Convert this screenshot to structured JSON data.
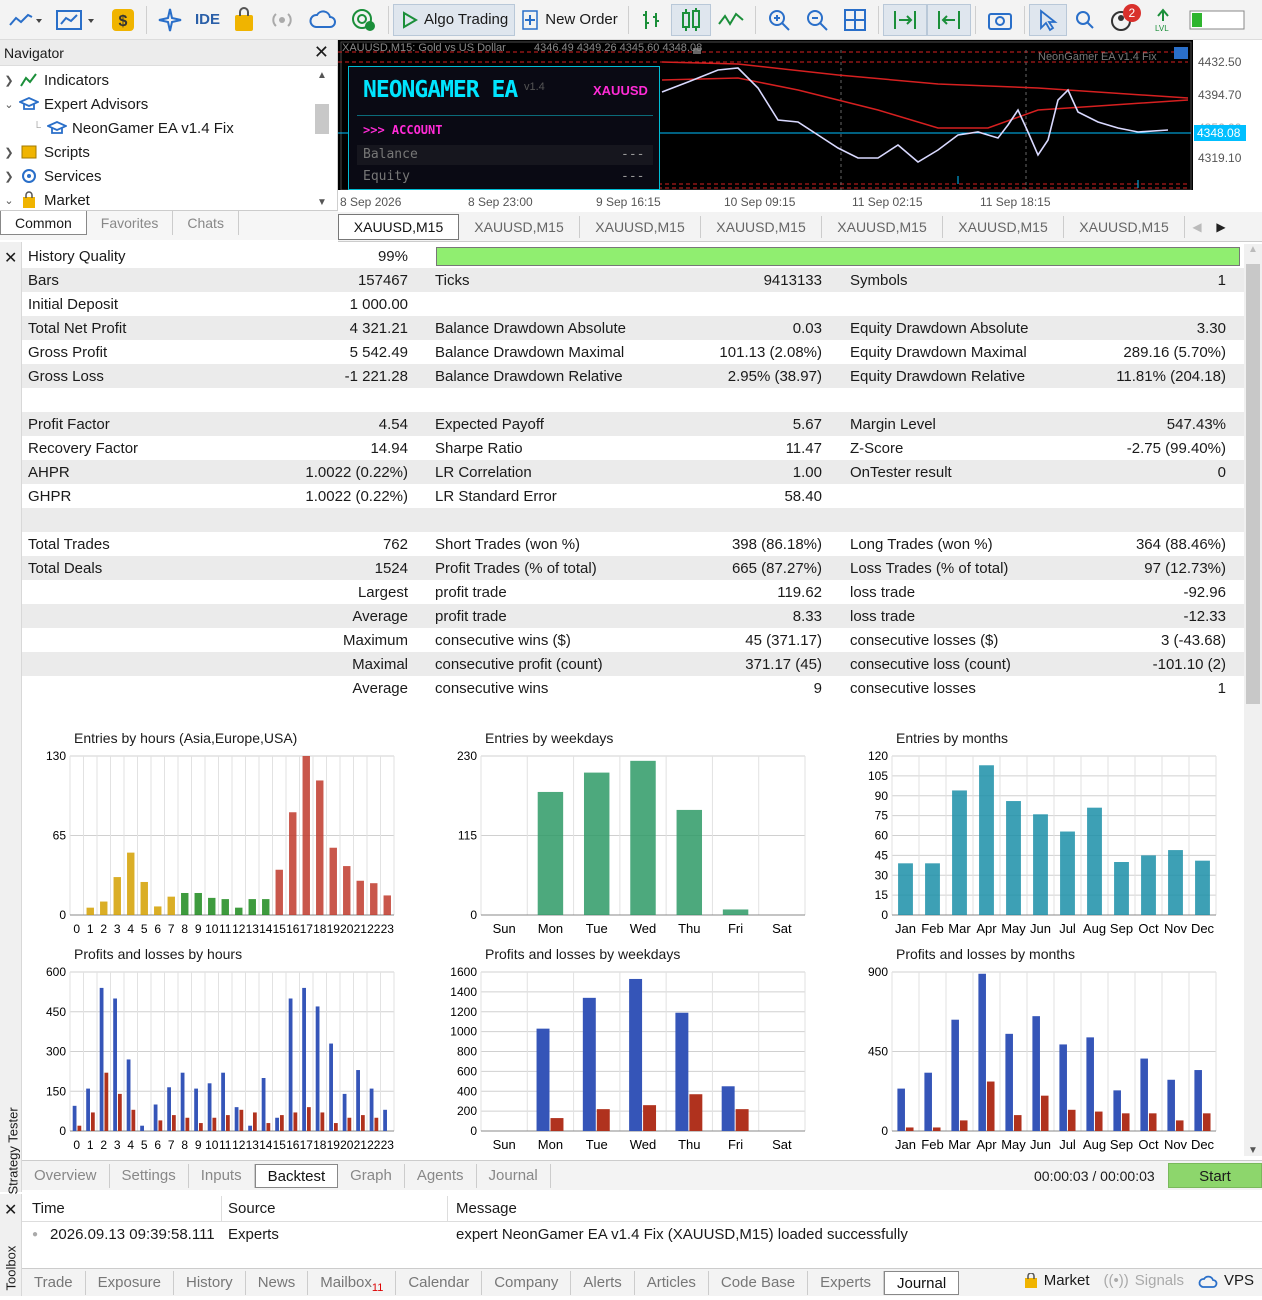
{
  "toolbar": {
    "algo_trading": "Algo Trading",
    "new_order": "New Order",
    "ide": "IDE",
    "notifications_count": "2",
    "icons": [
      "line-chart-icon",
      "dropdown-icon",
      "chart-type-icon",
      "dollar-icon",
      "sparkle-icon",
      "ide-icon",
      "shopping-bag-icon",
      "signal-icon",
      "cloud-icon",
      "vps-icon",
      "play-icon",
      "new-order-icon",
      "bar-chart-icon",
      "candle-chart-icon",
      "line-icon",
      "zoom-in-icon",
      "zoom-out-icon",
      "grid-icon",
      "autoscroll-icon",
      "chart-shift-icon",
      "screenshot-icon",
      "cursor-icon",
      "search-icon",
      "account-icon",
      "level-icon",
      "signal-strength-icon"
    ]
  },
  "navigator": {
    "title": "Navigator",
    "items": [
      {
        "label": "Indicators",
        "icon": "indicators-icon"
      },
      {
        "label": "Expert Advisors",
        "icon": "experts-icon"
      },
      {
        "label": "NeonGamer EA v1.4 Fix",
        "icon": "expert-hat-icon"
      },
      {
        "label": "Scripts",
        "icon": "scripts-icon"
      },
      {
        "label": "Services",
        "icon": "services-icon"
      },
      {
        "label": "Market",
        "icon": "market-icon"
      }
    ],
    "tabs": [
      "Common",
      "Favorites",
      "Chats"
    ]
  },
  "chart": {
    "symbol_header": "XAUUSD,M15: Gold vs US Dollar",
    "ohlc": "4346.49 4349.26 4345.60 4348.08",
    "ea_name": "NEONGAMER EA",
    "ea_version": "v1.4",
    "ea_symbol": "XAUUSD",
    "section": ">>> ACCOUNT",
    "rows": [
      {
        "label": "Balance",
        "value": "---"
      },
      {
        "label": "Equity",
        "value": "---"
      }
    ],
    "right_label": "NeonGamer EA v1.4 Fix",
    "price_labels": [
      "4432.50",
      "4394.70",
      "4356.00",
      "4348.08",
      "4319.10"
    ],
    "time_labels": [
      "8 Sep 2026",
      "8 Sep 23:00",
      "9 Sep 16:15",
      "10 Sep 09:15",
      "11 Sep 02:15",
      "11 Sep 18:15"
    ],
    "colors": {
      "bg": "#000000",
      "price": "#00bfff",
      "ma": "#d62020",
      "panel": "#00e5ff",
      "symbol": "#ff2bd6"
    }
  },
  "chart_tabs": [
    "XAUUSD,M15",
    "XAUUSD,M15",
    "XAUUSD,M15",
    "XAUUSD,M15",
    "XAUUSD,M15",
    "XAUUSD,M15",
    "XAUUSD,M15"
  ],
  "report": {
    "history_quality": {
      "label": "History Quality",
      "value": "99%",
      "fill": 0.99
    },
    "rows": [
      [
        "Bars",
        "157467",
        "Ticks",
        "9413133",
        "Symbols",
        "1"
      ],
      [
        "Initial Deposit",
        "1 000.00",
        "",
        "",
        "",
        ""
      ],
      [
        "Total Net Profit",
        "4 321.21",
        "Balance Drawdown Absolute",
        "0.03",
        "Equity Drawdown Absolute",
        "3.30"
      ],
      [
        "Gross Profit",
        "5 542.49",
        "Balance Drawdown Maximal",
        "101.13 (2.08%)",
        "Equity Drawdown Maximal",
        "289.16 (5.70%)"
      ],
      [
        "Gross Loss",
        "-1 221.28",
        "Balance Drawdown Relative",
        "2.95% (38.97)",
        "Equity Drawdown Relative",
        "11.81% (204.18)"
      ],
      [
        "",
        "",
        "",
        "",
        "",
        ""
      ],
      [
        "Profit Factor",
        "4.54",
        "Expected Payoff",
        "5.67",
        "Margin Level",
        "547.43%"
      ],
      [
        "Recovery Factor",
        "14.94",
        "Sharpe Ratio",
        "11.47",
        "Z-Score",
        "-2.75 (99.40%)"
      ],
      [
        "AHPR",
        "1.0022 (0.22%)",
        "LR Correlation",
        "1.00",
        "OnTester result",
        "0"
      ],
      [
        "GHPR",
        "1.0022 (0.22%)",
        "LR Standard Error",
        "58.40",
        "",
        ""
      ],
      [
        "",
        "",
        "",
        "",
        "",
        ""
      ],
      [
        "Total Trades",
        "762",
        "Short Trades (won %)",
        "398 (86.18%)",
        "Long Trades (won %)",
        "364 (88.46%)"
      ],
      [
        "Total Deals",
        "1524",
        "Profit Trades (% of total)",
        "665 (87.27%)",
        "Loss Trades (% of total)",
        "97 (12.73%)"
      ],
      [
        "",
        "Largest",
        "profit trade",
        "119.62",
        "loss trade",
        "-92.96"
      ],
      [
        "",
        "Average",
        "profit trade",
        "8.33",
        "loss trade",
        "-12.33"
      ],
      [
        "",
        "Maximum",
        "consecutive wins ($)",
        "45 (371.17)",
        "consecutive losses ($)",
        "3 (-43.68)"
      ],
      [
        "",
        "Maximal",
        "consecutive profit (count)",
        "371.17 (45)",
        "consecutive loss (count)",
        "-101.10 (2)"
      ],
      [
        "",
        "Average",
        "consecutive wins",
        "9",
        "consecutive losses",
        "1"
      ]
    ]
  },
  "chart_data": [
    {
      "type": "bar",
      "title": "Entries by hours (Asia,Europe,USA)",
      "categories": [
        "0",
        "1",
        "2",
        "3",
        "4",
        "5",
        "6",
        "7",
        "8",
        "9",
        "10",
        "11",
        "12",
        "13",
        "14",
        "15",
        "16",
        "17",
        "18",
        "19",
        "20",
        "21",
        "22",
        "23"
      ],
      "values": [
        0,
        6,
        11,
        31,
        51,
        27,
        7,
        15,
        18,
        18,
        14,
        13,
        6,
        13,
        13,
        37,
        84,
        130,
        110,
        55,
        40,
        28,
        26,
        16
      ],
      "colors": [
        "#d4a000",
        "#d4a000",
        "#d4a000",
        "#d4a000",
        "#d4a000",
        "#d4a000",
        "#d4a000",
        "#d4a000",
        "#1c8a1c",
        "#1c8a1c",
        "#1c8a1c",
        "#1c8a1c",
        "#1c8a1c",
        "#1c8a1c",
        "#1c8a1c",
        "#c0392b",
        "#c0392b",
        "#c0392b",
        "#c0392b",
        "#c0392b",
        "#c0392b",
        "#c0392b",
        "#c0392b",
        "#c0392b"
      ],
      "yticks": [
        "0",
        "65",
        "130"
      ],
      "ylim": [
        0,
        130
      ]
    },
    {
      "type": "bar",
      "title": "Entries by weekdays",
      "categories": [
        "Sun",
        "Mon",
        "Tue",
        "Wed",
        "Thu",
        "Fri",
        "Sat"
      ],
      "values": [
        0,
        178,
        206,
        223,
        152,
        8,
        0
      ],
      "color": "#2e9a66",
      "yticks": [
        "0",
        "115",
        "230"
      ],
      "ylim": [
        0,
        230
      ]
    },
    {
      "type": "bar",
      "title": "Entries by months",
      "categories": [
        "Jan",
        "Feb",
        "Mar",
        "Apr",
        "May",
        "Jun",
        "Jul",
        "Aug",
        "Sep",
        "Oct",
        "Nov",
        "Dec"
      ],
      "values": [
        39,
        39,
        94,
        113,
        86,
        76,
        63,
        81,
        40,
        45,
        49,
        41
      ],
      "color": "#1b8fa8",
      "yticks": [
        "0",
        "15",
        "30",
        "45",
        "60",
        "75",
        "90",
        "105",
        "120"
      ],
      "ylim": [
        0,
        120
      ]
    },
    {
      "type": "bar",
      "title": "Profits and losses by hours",
      "categories": [
        "0",
        "1",
        "2",
        "3",
        "4",
        "5",
        "6",
        "7",
        "8",
        "9",
        "10",
        "11",
        "12",
        "13",
        "14",
        "15",
        "16",
        "17",
        "18",
        "19",
        "20",
        "21",
        "22",
        "23"
      ],
      "series": [
        {
          "values": [
            95,
            160,
            540,
            500,
            270,
            20,
            100,
            165,
            220,
            160,
            180,
            220,
            90,
            20,
            200,
            50,
            500,
            540,
            470,
            330,
            140,
            230,
            160,
            80
          ],
          "color": "#3555b8"
        },
        {
          "values": [
            20,
            70,
            220,
            140,
            80,
            0,
            40,
            60,
            50,
            30,
            50,
            60,
            80,
            70,
            30,
            60,
            70,
            90,
            70,
            30,
            50,
            60,
            50,
            0
          ],
          "color": "#b0321e"
        }
      ],
      "yticks": [
        "0",
        "150",
        "300",
        "450",
        "600"
      ],
      "ylim": [
        0,
        600
      ]
    },
    {
      "type": "bar",
      "title": "Profits and losses by weekdays",
      "categories": [
        "Sun",
        "Mon",
        "Tue",
        "Wed",
        "Thu",
        "Fri",
        "Sat"
      ],
      "series": [
        {
          "values": [
            0,
            1030,
            1340,
            1530,
            1190,
            450,
            0
          ],
          "color": "#3555b8"
        },
        {
          "values": [
            0,
            130,
            220,
            260,
            370,
            220,
            0
          ],
          "color": "#b0321e"
        }
      ],
      "yticks": [
        "0",
        "200",
        "400",
        "600",
        "800",
        "1000",
        "1200",
        "1400",
        "1600"
      ],
      "ylim": [
        0,
        1600
      ]
    },
    {
      "type": "bar",
      "title": "Profits and losses by months",
      "categories": [
        "Jan",
        "Feb",
        "Mar",
        "Apr",
        "May",
        "Jun",
        "Jul",
        "Aug",
        "Sep",
        "Oct",
        "Nov",
        "Dec"
      ],
      "series": [
        {
          "values": [
            240,
            330,
            630,
            890,
            550,
            650,
            490,
            530,
            230,
            410,
            290,
            345
          ],
          "color": "#3555b8"
        },
        {
          "values": [
            20,
            20,
            60,
            280,
            90,
            200,
            120,
            110,
            100,
            100,
            60,
            100
          ],
          "color": "#b0321e"
        }
      ],
      "yticks": [
        "0",
        "450",
        "900"
      ],
      "ylim": [
        0,
        900
      ]
    }
  ],
  "strategy_tester": {
    "title": "Strategy Tester",
    "tabs": [
      "Overview",
      "Settings",
      "Inputs",
      "Backtest",
      "Graph",
      "Agents",
      "Journal"
    ],
    "time": "00:00:03 / 00:00:03",
    "start": "Start"
  },
  "journal": {
    "headers": [
      "Time",
      "Source",
      "Message"
    ],
    "rows": [
      {
        "time": "2026.09.13 09:39:58.111",
        "source": "Experts",
        "message": "expert NeonGamer EA v1.4 Fix (XAUUSD,M15) loaded successfully"
      }
    ]
  },
  "toolbox": {
    "title": "Toolbox",
    "tabs": [
      "Trade",
      "Exposure",
      "History",
      "News",
      "Mailbox",
      "Calendar",
      "Company",
      "Alerts",
      "Articles",
      "Code Base",
      "Experts",
      "Journal"
    ],
    "mailbox_count": "11",
    "right": {
      "market": "Market",
      "signals": "Signals",
      "vps": "VPS"
    }
  }
}
